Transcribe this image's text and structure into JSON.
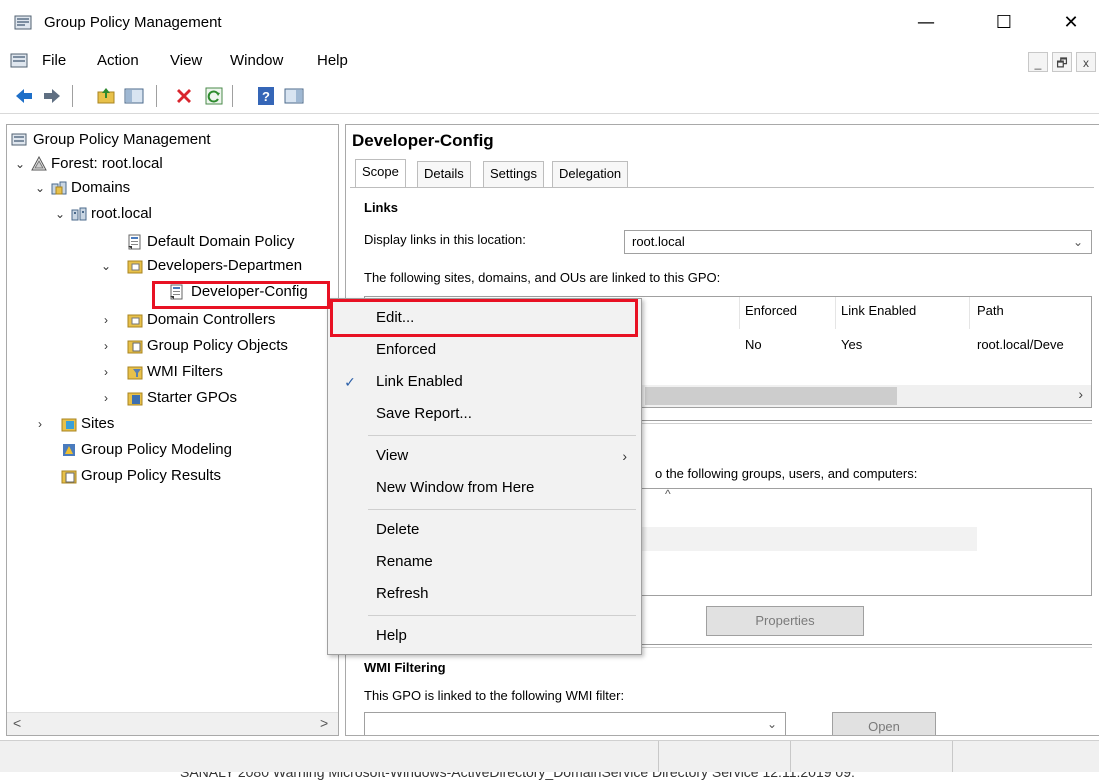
{
  "window": {
    "title": "Group Policy Management",
    "controls": {
      "minimize": "—",
      "maximize": "☐",
      "close": "✕"
    }
  },
  "menubar": {
    "items": [
      "File",
      "Action",
      "View",
      "Window",
      "Help"
    ],
    "mdi": [
      "_",
      "🗗",
      "x"
    ]
  },
  "toolbar": {
    "icons": [
      "back-arrow-icon",
      "forward-arrow-icon",
      "up-folder-icon",
      "show-hide-tree-icon",
      "delete-icon",
      "refresh-icon",
      "help-icon",
      "show-hide-action-pane-icon"
    ]
  },
  "tree": {
    "items": [
      {
        "label": "Group Policy Management",
        "icon": "gpm-console-icon"
      },
      {
        "label": "Forest: root.local",
        "icon": "forest-icon"
      },
      {
        "label": "Domains",
        "icon": "domains-icon"
      },
      {
        "label": "root.local",
        "icon": "domain-icon"
      },
      {
        "label": "Default Domain Policy",
        "icon": "gpo-link-icon"
      },
      {
        "label": "Developers-Departmen",
        "icon": "ou-folder-icon"
      },
      {
        "label": "Developer-Config",
        "icon": "gpo-link-icon"
      },
      {
        "label": "Domain Controllers",
        "icon": "ou-folder-icon"
      },
      {
        "label": "Group Policy Objects",
        "icon": "gpo-container-icon"
      },
      {
        "label": "WMI Filters",
        "icon": "wmi-filter-icon"
      },
      {
        "label": "Starter GPOs",
        "icon": "starter-gpo-icon"
      },
      {
        "label": "Sites",
        "icon": "sites-icon"
      },
      {
        "label": "Group Policy Modeling",
        "icon": "modeling-icon"
      },
      {
        "label": "Group Policy Results",
        "icon": "results-icon"
      }
    ]
  },
  "details": {
    "title": "Developer-Config",
    "tabs": [
      "Scope",
      "Details",
      "Settings",
      "Delegation"
    ],
    "links": {
      "heading": "Links",
      "location_label": "Display links in this location:",
      "location_value": "root.local",
      "linked_caption": "The following sites, domains, and OUs are linked to this GPO:",
      "columns": [
        "Enforced",
        "Link Enabled",
        "Path"
      ],
      "row": [
        "No",
        "Yes",
        "root.local/Deve"
      ]
    },
    "security": {
      "caption_fragment": "o the following groups, users, and computers:",
      "properties_button": "Properties"
    },
    "wmi": {
      "heading": "WMI Filtering",
      "caption": "This GPO is linked to the following WMI filter:",
      "open_button": "Open"
    }
  },
  "context_menu": {
    "items": [
      "Edit...",
      "Enforced",
      "Link Enabled",
      "Save Report...",
      "View",
      "New Window from Here",
      "Delete",
      "Rename",
      "Refresh",
      "Help"
    ],
    "checked": "Link Enabled"
  },
  "background_log": {
    "text": "SANALY     2080   Warning   Microsoft-Windows-ActiveDirectory_DomainService   Directory Service   12:11:2019 09:"
  },
  "colors": {
    "highlight_red": "#e81123",
    "check_blue": "#2b5fa8"
  }
}
